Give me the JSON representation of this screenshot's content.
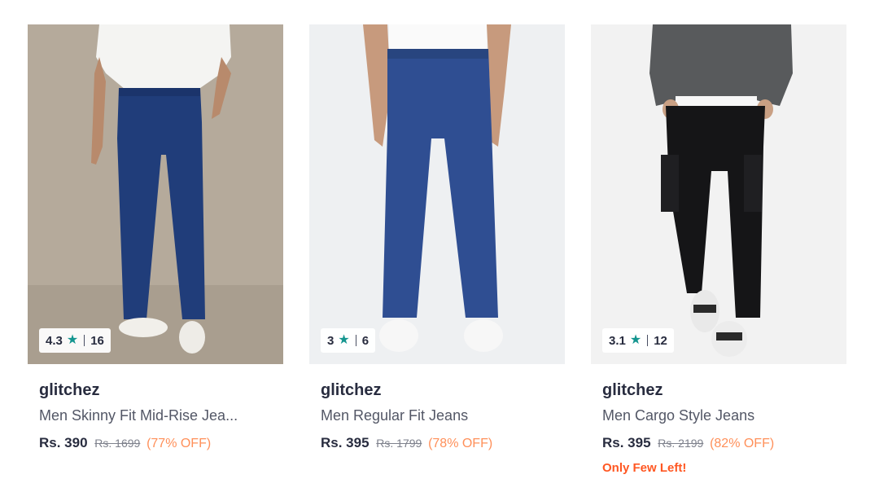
{
  "products": [
    {
      "rating": "4.3",
      "rating_count": "16",
      "brand": "glitchez",
      "title": "Men Skinny Fit Mid-Rise Jea...",
      "price": "Rs. 390",
      "mrp": "Rs. 1699",
      "discount": "(77% OFF)",
      "stock_note": ""
    },
    {
      "rating": "3",
      "rating_count": "6",
      "brand": "glitchez",
      "title": "Men Regular Fit Jeans",
      "price": "Rs. 395",
      "mrp": "Rs. 1799",
      "discount": "(78% OFF)",
      "stock_note": ""
    },
    {
      "rating": "3.1",
      "rating_count": "12",
      "brand": "glitchez",
      "title": "Men Cargo Style Jeans",
      "price": "Rs. 395",
      "mrp": "Rs. 2199",
      "discount": "(82% OFF)",
      "stock_note": "Only Few Left!"
    }
  ],
  "colors": {
    "rating_star": "#14958f",
    "discount": "#ff905a",
    "stock_alert": "#ff5722",
    "brand_text": "#282c3f"
  },
  "icons": {
    "rating": "star-icon"
  }
}
